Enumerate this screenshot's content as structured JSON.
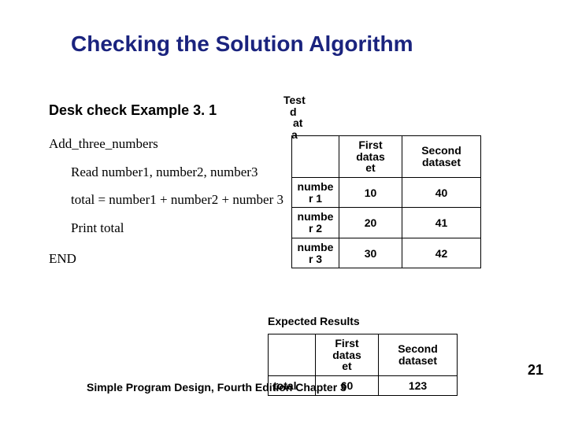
{
  "title": "Checking the Solution Algorithm",
  "subtitle": "Desk check Example 3. 1",
  "algorithm": {
    "name": "Add_three_numbers",
    "read": "Read number1, number2, number3",
    "assign": "total = number1 + number2 + number 3",
    "print": "Print total",
    "end": "END"
  },
  "testDataLabel": {
    "l1": "Test",
    "l2": "d",
    "l3": "at",
    "l4": "a"
  },
  "table1": {
    "headers": {
      "blank": "",
      "first_a": "First",
      "first_b": "datas",
      "first_c": "et",
      "second_a": "Second",
      "second_b": "dataset"
    },
    "rows": [
      {
        "label_a": "numbe",
        "label_b": "r 1",
        "first": "10",
        "second": "40"
      },
      {
        "label_a": "numbe",
        "label_b": "r 2",
        "first": "20",
        "second": "41"
      },
      {
        "label_a": "numbe",
        "label_b": "r 3",
        "first": "30",
        "second": "42"
      }
    ]
  },
  "expectedLabel": "Expected Results",
  "table2": {
    "headers": {
      "blank": "",
      "first_a": "First",
      "first_b": "datas",
      "first_c": "et",
      "second_a": "Second",
      "second_b": "dataset"
    },
    "row": {
      "label": "total",
      "first": "60",
      "second": "123"
    }
  },
  "footer": "Simple Program Design, Fourth Edition       Chapter 3",
  "page": "21"
}
